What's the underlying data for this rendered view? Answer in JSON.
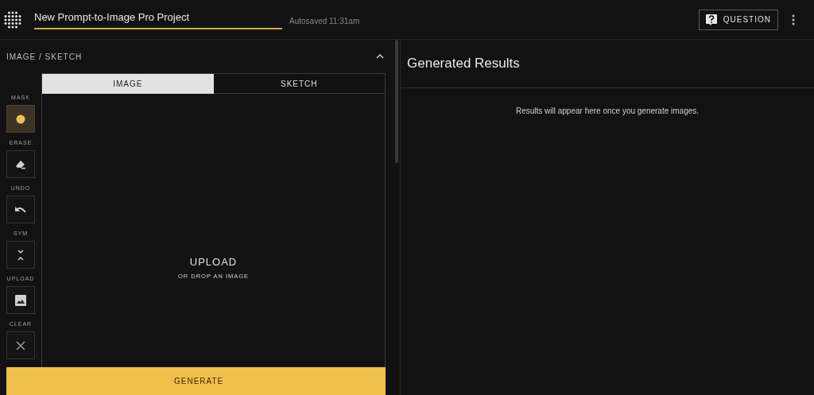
{
  "header": {
    "project_name": "New Prompt-to-Image Pro Project",
    "autosave": "Autosaved 11:31am",
    "question_button": "QUESTION"
  },
  "editor": {
    "title": "IMAGE / SKETCH",
    "expanded": true,
    "tabs": [
      {
        "label": "IMAGE",
        "selected": true
      },
      {
        "label": "SKETCH",
        "selected": false
      }
    ],
    "tools": [
      {
        "kind": "mask",
        "label": "MASK",
        "selected": true
      },
      {
        "kind": "erase",
        "label": "ERASE",
        "selected": false
      },
      {
        "kind": "undo",
        "label": "UNDO",
        "selected": false
      },
      {
        "kind": "sym",
        "label": "SYM",
        "selected": false
      },
      {
        "kind": "upload",
        "label": "UPLOAD",
        "selected": false
      },
      {
        "kind": "clear",
        "label": "CLEAR",
        "selected": false
      }
    ],
    "dropzone": {
      "title": "UPLOAD",
      "subtitle": "OR DROP AN IMAGE"
    },
    "generate_button": "GENERATE"
  },
  "results": {
    "title": "Generated Results",
    "empty_message": "Results will appear here once you generate images."
  }
}
